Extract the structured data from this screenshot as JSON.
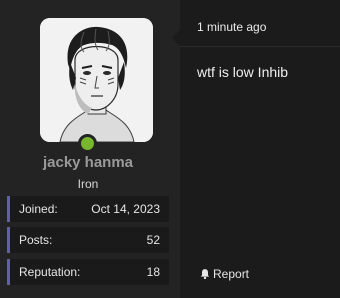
{
  "post": {
    "timestamp": "1 minute ago",
    "message": "wtf is low Inhib",
    "report_label": "Report",
    "report_icon": "bell-icon"
  },
  "user": {
    "name": "jacky hanma",
    "title": "Iron",
    "status": "online",
    "status_color": "#76b82a",
    "accent_color": "#5a5fbd",
    "stats": {
      "joined_label": "Joined:",
      "joined_value": "Oct 14, 2023",
      "posts_label": "Posts:",
      "posts_value": "52",
      "reputation_label": "Reputation:",
      "reputation_value": "18"
    }
  }
}
